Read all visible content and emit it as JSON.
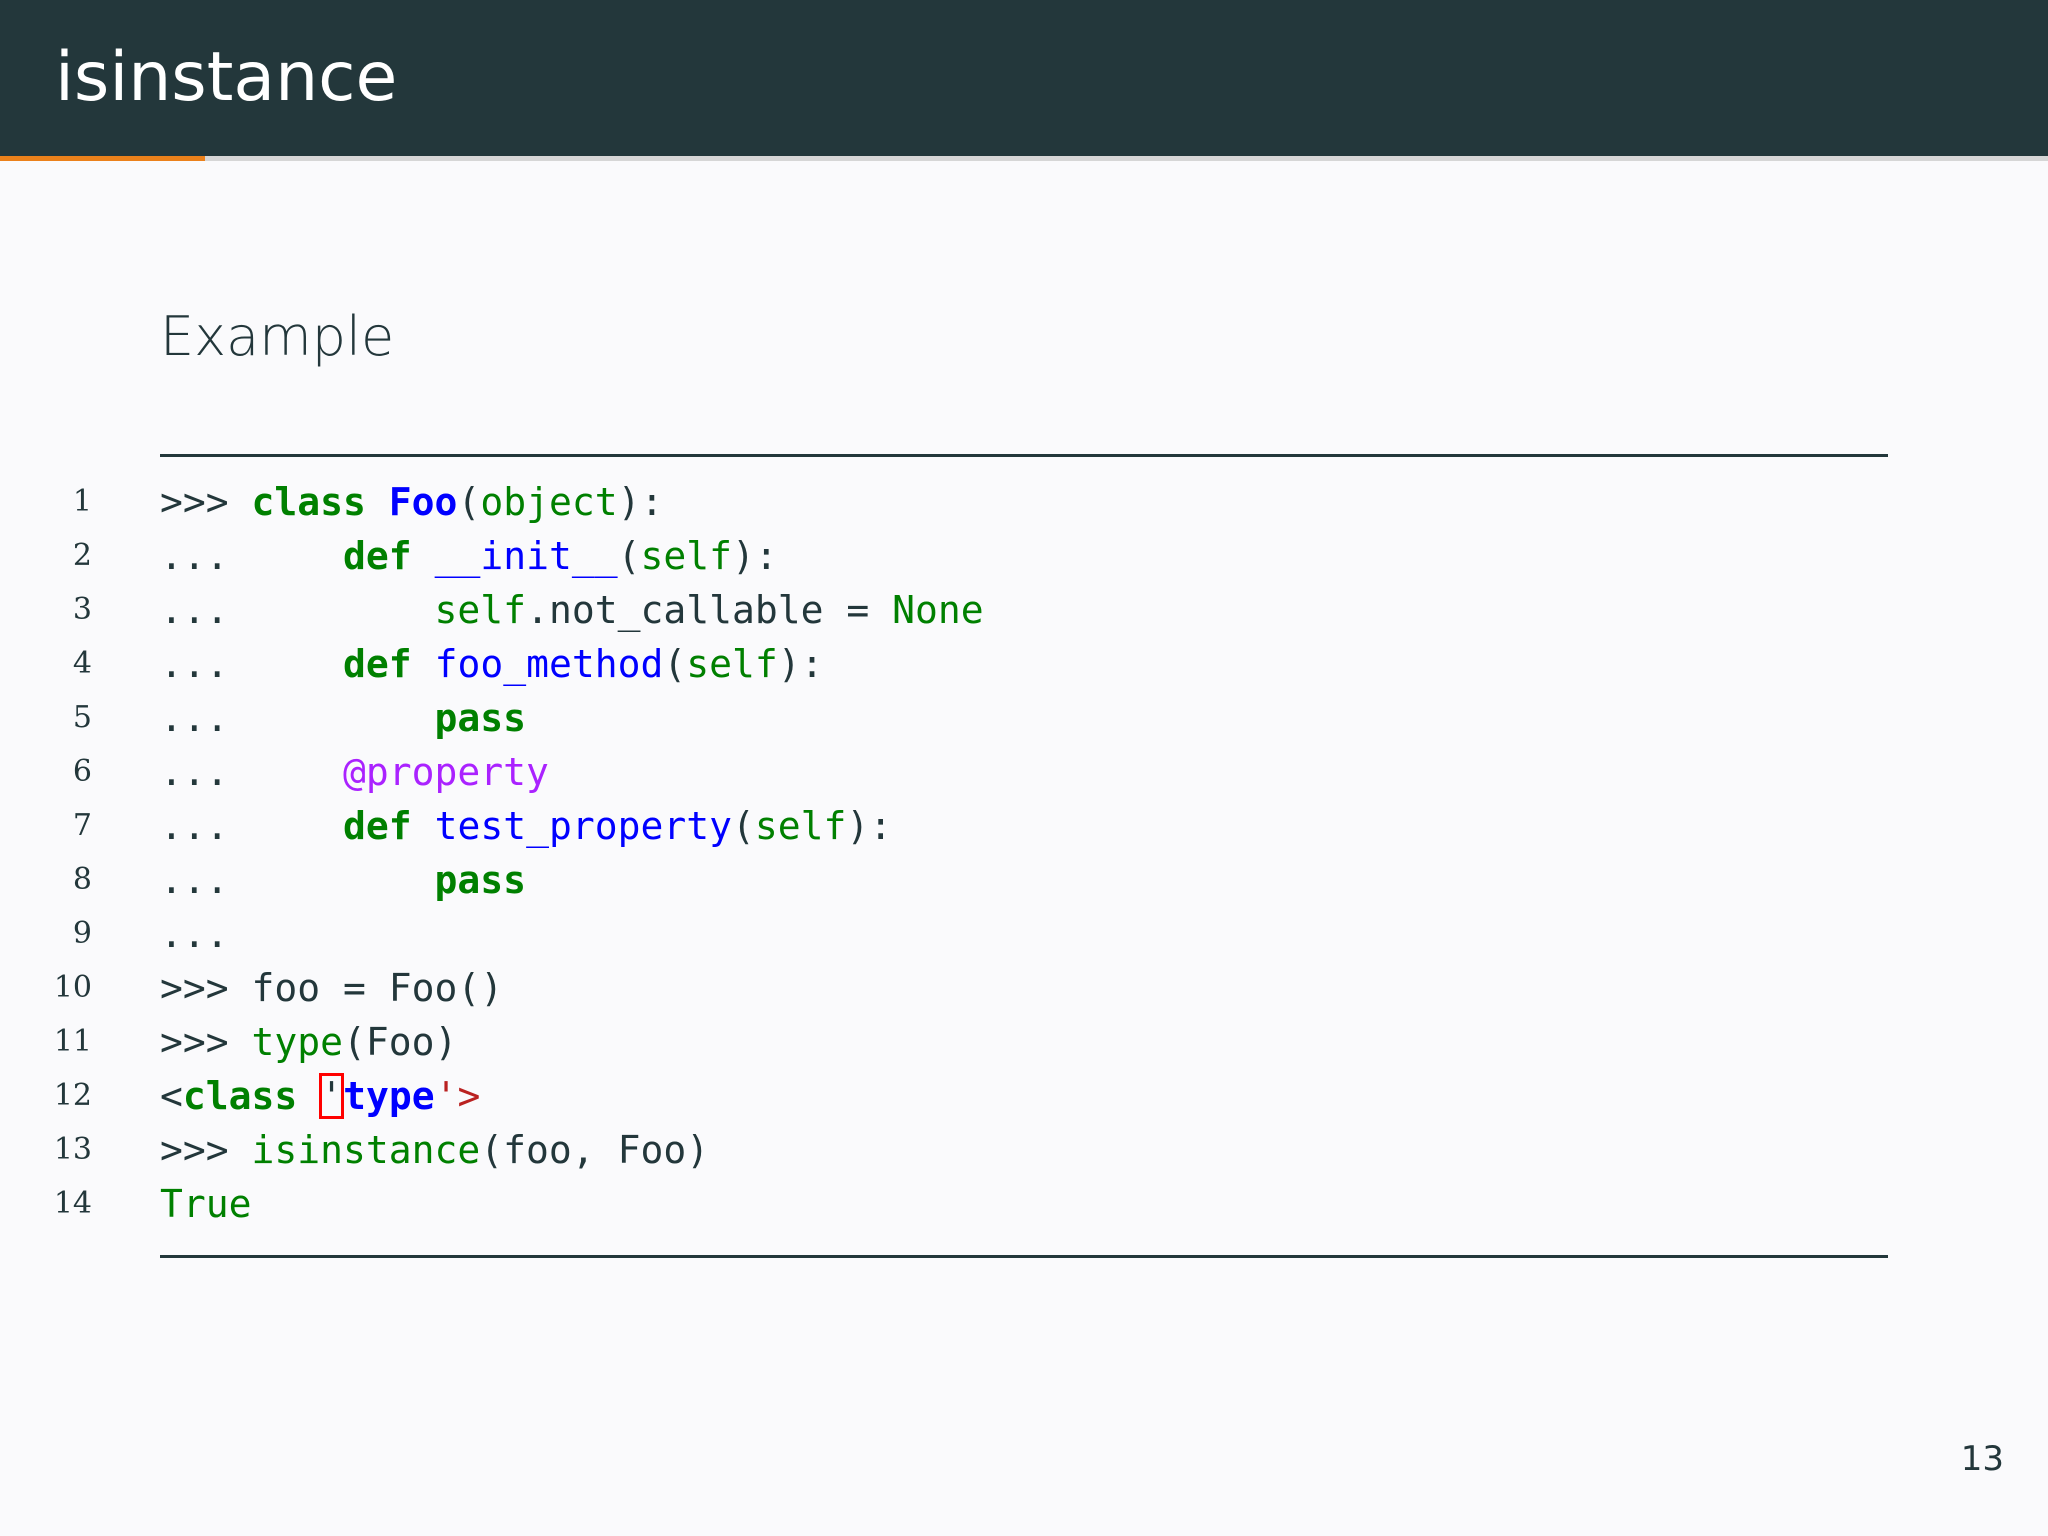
{
  "slide": {
    "title": "isinstance",
    "block_title": "Example",
    "page_number": "13",
    "progress_fraction": 0.1
  },
  "colors": {
    "header_bg": "#23373b",
    "accent": "#eb811b",
    "background": "#fafafc",
    "keyword": "#008000",
    "name": "#0000ff",
    "decorator": "#aa22ff",
    "string": "#ba2121"
  },
  "code_lines": [
    {
      "n": "1",
      "tokens": [
        {
          "t": ">>> ",
          "c": "prompt"
        },
        {
          "t": "class",
          "c": "kw"
        },
        {
          "t": " ",
          "c": "plain"
        },
        {
          "t": "Foo",
          "c": "cls"
        },
        {
          "t": "(",
          "c": "plain"
        },
        {
          "t": "object",
          "c": "builtin"
        },
        {
          "t": "):",
          "c": "plain"
        }
      ]
    },
    {
      "n": "2",
      "tokens": [
        {
          "t": "...     ",
          "c": "prompt"
        },
        {
          "t": "def",
          "c": "kw"
        },
        {
          "t": " ",
          "c": "plain"
        },
        {
          "t": "__init__",
          "c": "fn"
        },
        {
          "t": "(",
          "c": "plain"
        },
        {
          "t": "self",
          "c": "builtin"
        },
        {
          "t": "):",
          "c": "plain"
        }
      ]
    },
    {
      "n": "3",
      "tokens": [
        {
          "t": "...         ",
          "c": "prompt"
        },
        {
          "t": "self",
          "c": "builtin"
        },
        {
          "t": ".not_callable = ",
          "c": "plain"
        },
        {
          "t": "None",
          "c": "const"
        }
      ]
    },
    {
      "n": "4",
      "tokens": [
        {
          "t": "...     ",
          "c": "prompt"
        },
        {
          "t": "def",
          "c": "kw"
        },
        {
          "t": " ",
          "c": "plain"
        },
        {
          "t": "foo_method",
          "c": "fn"
        },
        {
          "t": "(",
          "c": "plain"
        },
        {
          "t": "self",
          "c": "builtin"
        },
        {
          "t": "):",
          "c": "plain"
        }
      ]
    },
    {
      "n": "5",
      "tokens": [
        {
          "t": "...         ",
          "c": "prompt"
        },
        {
          "t": "pass",
          "c": "kw"
        }
      ]
    },
    {
      "n": "6",
      "tokens": [
        {
          "t": "...     ",
          "c": "prompt"
        },
        {
          "t": "@property",
          "c": "deco"
        }
      ]
    },
    {
      "n": "7",
      "tokens": [
        {
          "t": "...     ",
          "c": "prompt"
        },
        {
          "t": "def",
          "c": "kw"
        },
        {
          "t": " ",
          "c": "plain"
        },
        {
          "t": "test_property",
          "c": "fn"
        },
        {
          "t": "(",
          "c": "plain"
        },
        {
          "t": "self",
          "c": "builtin"
        },
        {
          "t": "):",
          "c": "plain"
        }
      ]
    },
    {
      "n": "8",
      "tokens": [
        {
          "t": "...         ",
          "c": "prompt"
        },
        {
          "t": "pass",
          "c": "kw"
        }
      ]
    },
    {
      "n": "9",
      "tokens": [
        {
          "t": "...",
          "c": "prompt"
        }
      ]
    },
    {
      "n": "10",
      "tokens": [
        {
          "t": ">>> ",
          "c": "prompt"
        },
        {
          "t": "foo = Foo()",
          "c": "plain"
        }
      ]
    },
    {
      "n": "11",
      "tokens": [
        {
          "t": ">>> ",
          "c": "prompt"
        },
        {
          "t": "type",
          "c": "builtin"
        },
        {
          "t": "(Foo)",
          "c": "plain"
        }
      ]
    },
    {
      "n": "12",
      "tokens": [
        {
          "t": "<",
          "c": "plain"
        },
        {
          "t": "class",
          "c": "kw"
        },
        {
          "t": " ",
          "c": "plain"
        },
        {
          "t": "'",
          "c": "err"
        },
        {
          "t": "type",
          "c": "cls"
        },
        {
          "t": "'>",
          "c": "str"
        }
      ]
    },
    {
      "n": "13",
      "tokens": [
        {
          "t": ">>> ",
          "c": "prompt"
        },
        {
          "t": "isinstance",
          "c": "builtin"
        },
        {
          "t": "(foo, Foo)",
          "c": "plain"
        }
      ]
    },
    {
      "n": "14",
      "tokens": [
        {
          "t": "True",
          "c": "const"
        }
      ]
    }
  ]
}
